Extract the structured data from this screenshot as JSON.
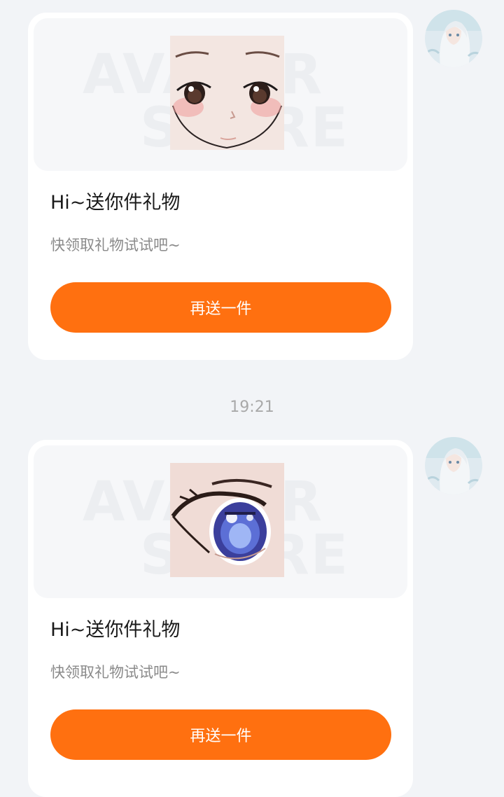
{
  "messages": [
    {
      "watermark_line1": "AVATAR",
      "watermark_line2": "STORE",
      "item_icon": "face-makeup-icon",
      "title": "Hi~送你件礼物",
      "subtitle": "快领取礼物试试吧~",
      "button_label": "再送一件",
      "avatar_icon": "anime-girl-avatar"
    },
    {
      "watermark_line1": "AVATAR",
      "watermark_line2": "STORE",
      "item_icon": "anime-eye-icon",
      "title": "Hi~送你件礼物",
      "subtitle": "快领取礼物试试吧~",
      "button_label": "再送一件",
      "avatar_icon": "anime-girl-avatar"
    }
  ],
  "timestamp": "19:21",
  "colors": {
    "background": "#f2f4f7",
    "card": "#ffffff",
    "button": "#ff7010",
    "timestamp": "#a9a9a9"
  }
}
